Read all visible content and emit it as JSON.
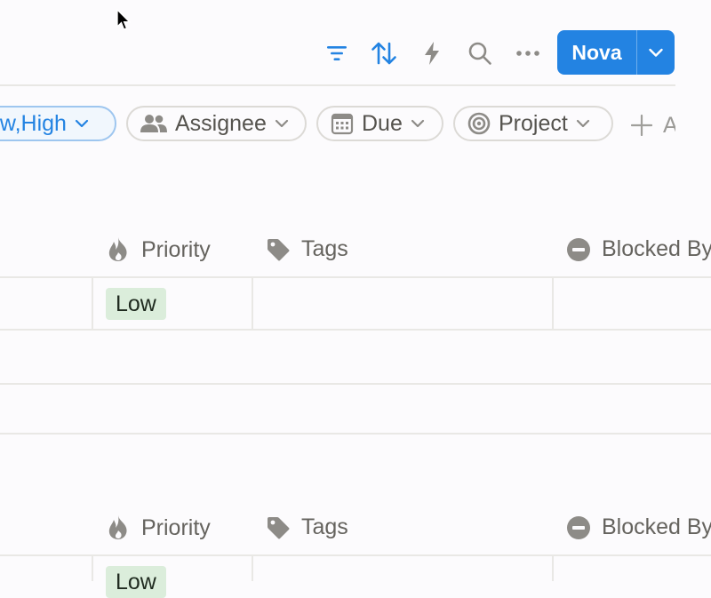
{
  "toolbar": {
    "filter_icon": "filter-icon",
    "sort_icon": "sort-icon",
    "automation_icon": "lightning-icon",
    "search_icon": "search-icon",
    "more_icon": "more-icon",
    "new_button_label": "Nova",
    "accent_color": "#2383e2"
  },
  "filters": {
    "priority_value": "ow,High",
    "assignee_label": "Assignee",
    "due_label": "Due",
    "project_label": "Project",
    "add_label": "A"
  },
  "groups": [
    {
      "columns": {
        "priority": "Priority",
        "tags": "Tags",
        "blocked_by": "Blocked By"
      },
      "row_priority": "Low"
    },
    {
      "columns": {
        "priority": "Priority",
        "tags": "Tags",
        "blocked_by": "Blocked By"
      },
      "row_priority": "Low"
    }
  ],
  "colors": {
    "low_tag_bg": "#dbeddb",
    "icon_blue": "#2383e2",
    "icon_gray": "#8d8b87"
  }
}
